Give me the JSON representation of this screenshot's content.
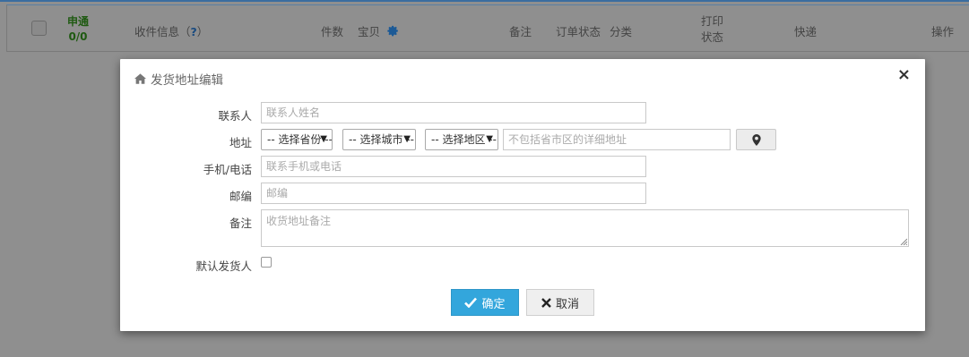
{
  "table_header": {
    "apply_label": "申通",
    "apply_count": "0/0",
    "recipient_info": "收件信息（",
    "recipient_help": "?",
    "recipient_close": "）",
    "quantity": "件数",
    "item": "宝贝",
    "remark": "备注",
    "order_status": "订单状态",
    "category": "分类",
    "print_status_line1": "打印",
    "print_status_line2": "状态",
    "express": "快递",
    "actions": "操作"
  },
  "modal": {
    "title": "发货地址编辑",
    "close_glyph": "×",
    "fields": {
      "contact_label": "联系人",
      "contact_placeholder": "联系人姓名",
      "address_label": "地址",
      "province_selected": "-- 选择省份 --",
      "city_selected": "-- 选择城市 --",
      "district_selected": "-- 选择地区 --",
      "address_detail_placeholder": "不包括省市区的详细地址",
      "phone_label": "手机/电话",
      "phone_placeholder": "联系手机或电话",
      "zip_label": "邮编",
      "zip_placeholder": "邮编",
      "remark_label": "备注",
      "remark_placeholder": "收货地址备注",
      "default_sender_label": "默认发货人"
    },
    "buttons": {
      "confirm": "确定",
      "cancel": "取消"
    }
  },
  "colors": {
    "primary": "#33a6dc",
    "overlay": "#8f8f8f",
    "apply_green": "#1f5a12"
  },
  "icons": {
    "title": "home-icon",
    "location": "map-marker-icon",
    "confirm": "check-icon",
    "cancel": "x-icon",
    "settings": "gear-icon"
  }
}
